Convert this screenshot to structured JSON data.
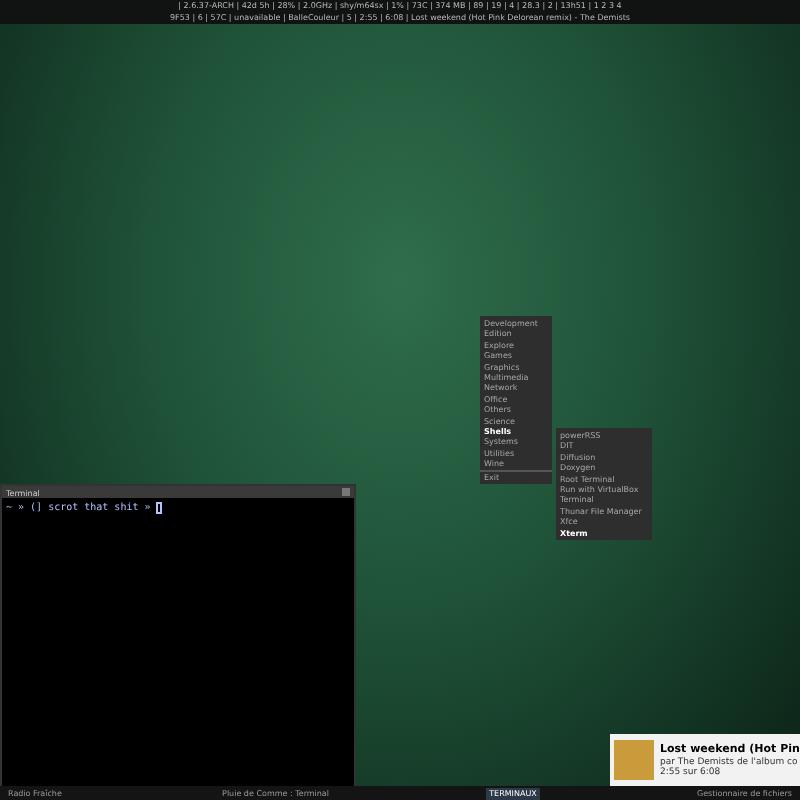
{
  "top_bar": {
    "status_line": "| 2.6.37-ARCH | 42d 5h | 28% | 2.0GHz | shy/m64sx | 1% | 73C | 374 MB | 89 | 19 | 4 | 28.3 | 2 | 13h51 | 1 2 3 4",
    "music_line": "9F53 | 6 | 57C | unavailable | BalleCouleur | 5 | 2:55 | 6:08 | Lost weekend (Hot Pink Delorean remix) - The Demists"
  },
  "menu": {
    "items": [
      {
        "label": "Development",
        "selected": false,
        "has_submenu": true
      },
      {
        "label": "Edition",
        "selected": false,
        "has_submenu": true
      },
      {
        "label": "Explore",
        "selected": false,
        "has_submenu": true
      },
      {
        "label": "Games",
        "selected": false,
        "has_submenu": true
      },
      {
        "label": "Graphics",
        "selected": false,
        "has_submenu": true
      },
      {
        "label": "Multimedia",
        "selected": false,
        "has_submenu": true
      },
      {
        "label": "Network",
        "selected": false,
        "has_submenu": true
      },
      {
        "label": "Office",
        "selected": false,
        "has_submenu": true
      },
      {
        "label": "Others",
        "selected": false,
        "has_submenu": true
      },
      {
        "label": "Science",
        "selected": false,
        "has_submenu": true
      },
      {
        "label": "Shells",
        "selected": true,
        "has_submenu": true
      },
      {
        "label": "Systems",
        "selected": false,
        "has_submenu": true
      },
      {
        "label": "Utilities",
        "selected": false,
        "has_submenu": true
      },
      {
        "label": "Wine",
        "selected": false,
        "has_submenu": true
      },
      {
        "label": "Exit",
        "selected": false,
        "has_submenu": false
      }
    ]
  },
  "submenu": {
    "items": [
      {
        "label": "powerRSS",
        "selected": false
      },
      {
        "label": "DIT",
        "selected": false
      },
      {
        "label": "Diffusion",
        "selected": false
      },
      {
        "label": "Doxygen",
        "selected": false
      },
      {
        "label": "Root Terminal",
        "selected": false
      },
      {
        "label": "Run with VirtualBox",
        "selected": false
      },
      {
        "label": "Terminal",
        "selected": false
      },
      {
        "label": "Thunar File Manager",
        "selected": false
      },
      {
        "label": "Xfce",
        "selected": false
      },
      {
        "label": "Xterm",
        "selected": true
      }
    ]
  },
  "terminal": {
    "title": "Terminal",
    "prompt": "~ » (] scrot that shit » "
  },
  "notification": {
    "title": "Lost weekend (Hot Pin",
    "subtitle": "par The Demists de l'album co",
    "time": "2:55 sur 6:08"
  },
  "taskbar": {
    "items": [
      {
        "label": "Radio Fraîche",
        "selected": false
      },
      {
        "label": "Pluie de Comme : Terminal",
        "selected": false
      },
      {
        "label": "TERMINAUX",
        "selected": true
      },
      {
        "label": "Gestionnaire de fichiers",
        "selected": false
      }
    ]
  }
}
